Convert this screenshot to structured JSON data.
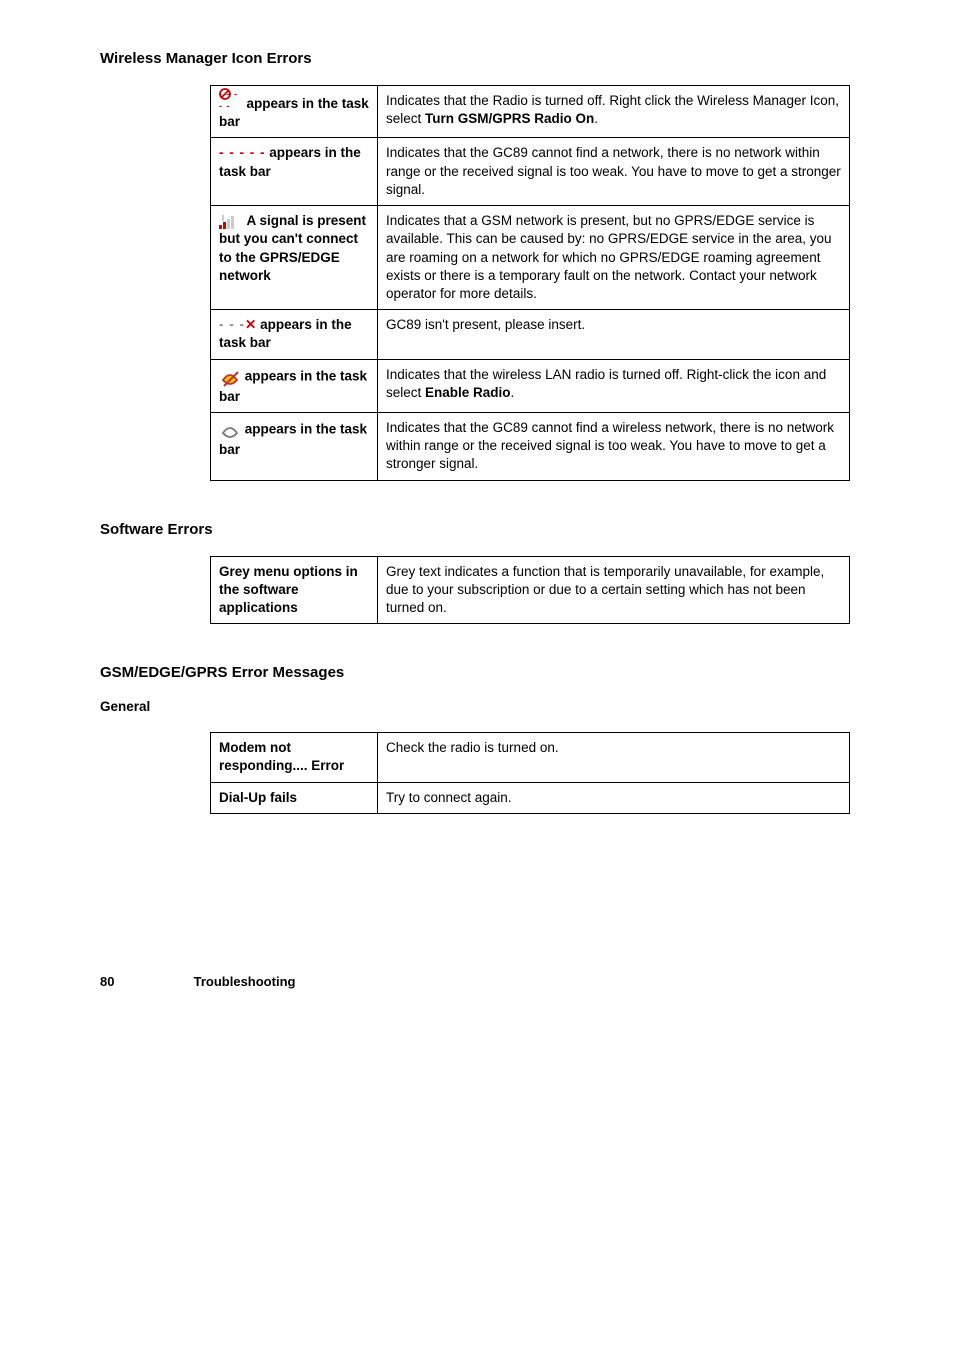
{
  "sections": {
    "wireless": {
      "title": "Wireless Manager Icon Errors",
      "rows": [
        {
          "label_html": "<span style=\"display:inline-block;position:relative;width:20px;height:16px;\"><svg width=\"16\" height=\"16\" style=\"position:absolute;top:-4px;left:0;\"><circle cx=\"6\" cy=\"6\" r=\"5\" fill=\"none\" stroke=\"#c00\" stroke-width=\"1.8\"/><line x1=\"2.5\" y1=\"9.5\" x2=\"9.5\" y2=\"2.5\" stroke=\"#c00\" stroke-width=\"1.8\"/></svg><span class=\"sig-red-dash\" style=\"position:absolute;bottom:-4px;left:0;font-size:9px;\">- - - - -</span></span>&nbsp;&nbsp;appears in the task bar",
          "label_name": "icon-radio-off-row",
          "icon_name": "radio-off-icon",
          "desc": "Indicates that the Radio is turned off. Right click the Wireless Manager Icon, select <b>Turn GSM/GPRS Radio On</b>."
        },
        {
          "label_html": "<span class=\"sig-red-dash\">- - - - -</span> appears in the task bar",
          "label_name": "icon-no-network-row",
          "icon_name": "no-network-icon",
          "desc": "Indicates that the GC89 cannot find a network, there is no network within range or the received signal is too weak. You have to move to get a stronger signal."
        },
        {
          "label_html": "<svg width=\"20\" height=\"14\"><rect x=\"0\"  y=\"10\" width=\"3\" height=\"4\" fill=\"#c00\"/><rect x=\"4\"  y=\"7\"  width=\"3\" height=\"7\" fill=\"#c00\"/><rect x=\"8\"  y=\"4\"  width=\"3\" height=\"10\" fill=\"#ccc\"/><rect x=\"12\" y=\"1\"  width=\"3\" height=\"13\" fill=\"#ccc\"/><rect x=\"3\"  y=\"0\"  width=\"2\" height=\"6\" fill=\"#ccc\"/></svg>&nbsp;&nbsp;A signal is present but you can't connect to the GPRS/EDGE network",
          "label_name": "icon-signal-no-gprs-row",
          "icon_name": "signal-bars-partial-icon",
          "desc": "Indicates that a GSM network is present, but no GPRS/EDGE service is available. This can be caused by: no GPRS/EDGE service in the area, you are roaming on a network for which no GPRS/EDGE roaming agreement exists or there is a temporary fault on the network. Contact your network operator for more details."
        },
        {
          "label_html": "<span class=\"sig-grey-dash\">- - -</span><span class=\"red-x\">✕</span> appears in the task bar",
          "label_name": "icon-not-present-row",
          "icon_name": "card-absent-icon",
          "desc": "GC89 isn't present, please insert."
        },
        {
          "label_html": "<svg width=\"22\" height=\"22\"><path d=\"M4 14 Q11 4 18 14 Q11 22 4 14 Z\" fill=\"#f2c200\" stroke=\"#b33\" stroke-width=\"1.8\"/><line x1=\"5\" y1=\"20\" x2=\"19\" y2=\"6\" stroke=\"#b33\" stroke-width=\"2\"/></svg>&nbsp;appears in the task bar",
          "label_name": "icon-wlan-off-row",
          "icon_name": "wlan-disabled-icon",
          "desc": "Indicates that the wireless LAN radio is turned off. Right-click the icon and select <b>Enable Radio</b>."
        },
        {
          "label_html": "<svg width=\"22\" height=\"22\"><path d=\"M4 14 Q11 4 18 14 Q11 22 4 14 Z\" fill=\"none\" stroke=\"#777\" stroke-width=\"1.8\"/></svg>&nbsp;appears in the task bar",
          "label_name": "icon-wlan-no-net-row",
          "icon_name": "wlan-no-network-icon",
          "desc": "Indicates that the GC89 cannot find a wireless network, there is no network within range or the received signal is too weak. You have to move to get a stronger signal."
        }
      ]
    },
    "software": {
      "title": "Software Errors",
      "rows": [
        {
          "label": "Grey menu options in the software applications",
          "label_name": "grey-menu-row",
          "desc": "Grey text indicates a function that is temporarily unavailable, for example, due to your subscription or due to a certain setting which has not been turned on."
        }
      ]
    },
    "gsm": {
      "title": "GSM/EDGE/GPRS Error Messages",
      "subhead": "General",
      "rows": [
        {
          "label": "Modem not responding.... Error",
          "label_name": "modem-not-responding-row",
          "desc": "Check the radio is turned on."
        },
        {
          "label": "Dial-Up fails",
          "label_name": "dialup-fails-row",
          "desc": "Try to connect again."
        }
      ]
    }
  },
  "footer": {
    "page": "80",
    "chapter": "Troubleshooting"
  }
}
